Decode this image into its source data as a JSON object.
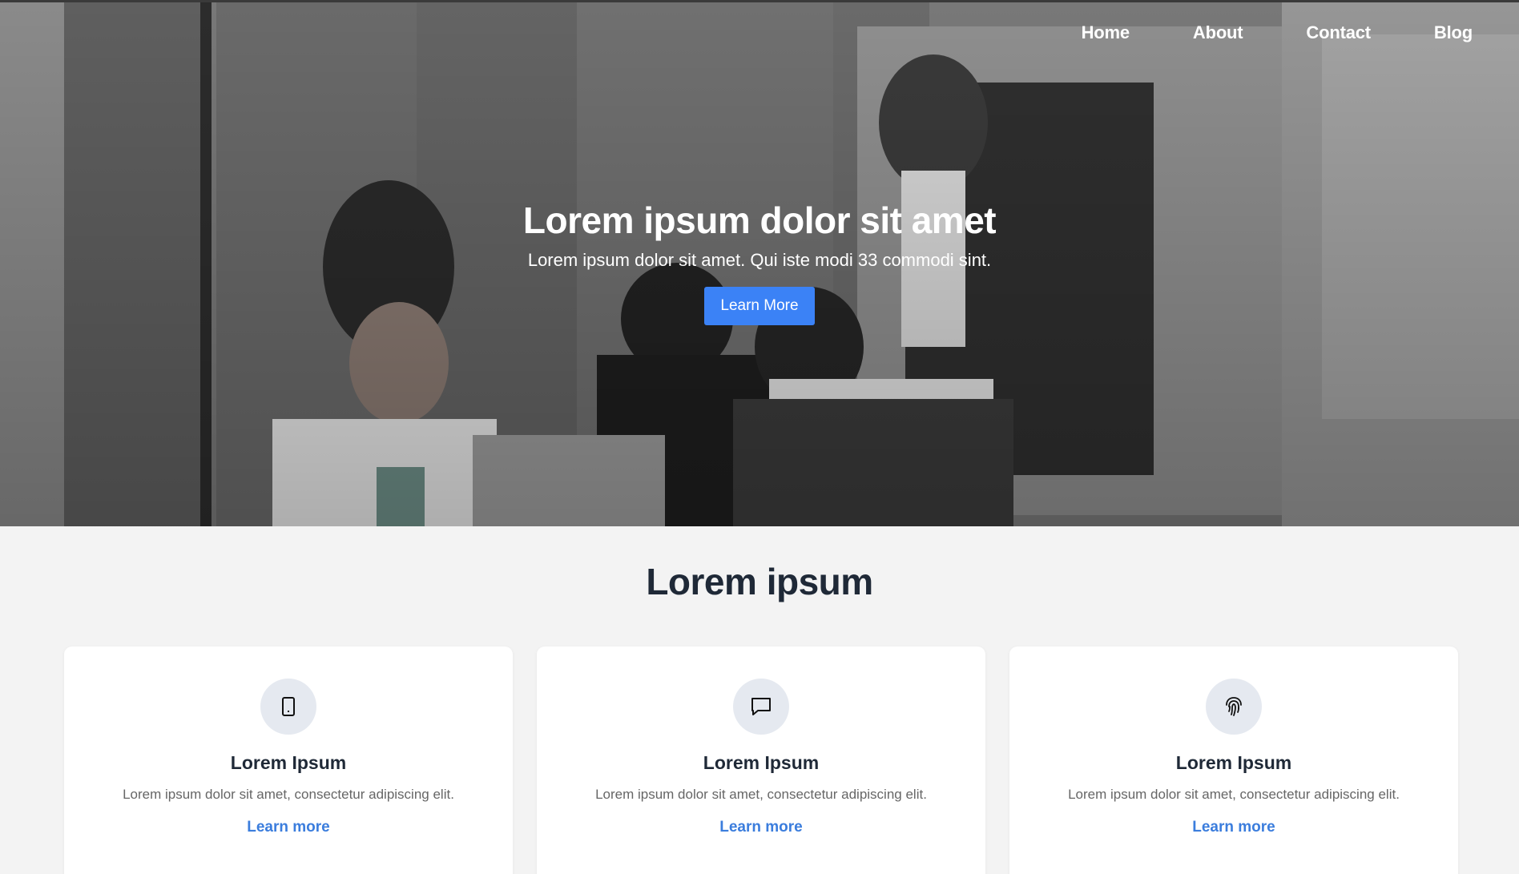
{
  "nav": {
    "items": [
      {
        "label": "Home"
      },
      {
        "label": "About"
      },
      {
        "label": "Contact"
      },
      {
        "label": "Blog"
      }
    ]
  },
  "hero": {
    "title": "Lorem ipsum dolor sit amet",
    "subtitle": "Lorem ipsum dolor sit amet. Qui iste modi 33 commodi sint.",
    "button_label": "Learn More"
  },
  "features": {
    "title": "Lorem ipsum",
    "cards": [
      {
        "icon": "tablet-icon",
        "title": "Lorem Ipsum",
        "text": "Lorem ipsum dolor sit amet, consectetur adipiscing elit.",
        "link": "Learn more"
      },
      {
        "icon": "chat-bubble-icon",
        "title": "Lorem Ipsum",
        "text": "Lorem ipsum dolor sit amet, consectetur adipiscing elit.",
        "link": "Learn more"
      },
      {
        "icon": "fingerprint-icon",
        "title": "Lorem Ipsum",
        "text": "Lorem ipsum dolor sit amet, consectetur adipiscing elit.",
        "link": "Learn more"
      }
    ]
  },
  "colors": {
    "accent": "#3b82f6",
    "link": "#3b7ddd",
    "heading": "#1f2937",
    "section_bg": "#f3f3f3"
  }
}
